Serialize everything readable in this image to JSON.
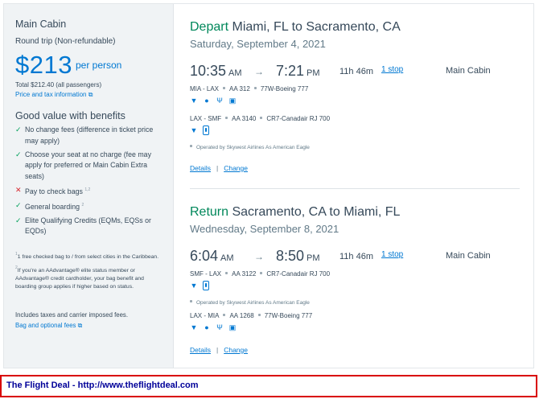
{
  "fare": {
    "cabin_name": "Main Cabin",
    "trip_type": "Round trip (Non-refundable)",
    "price_symbol": "$",
    "price_amount": "213",
    "price_suffix": "per person",
    "total_text": "Total $212.40 (all passengers)",
    "price_tax_link": "Price and tax information",
    "value_heading": "Good value with benefits",
    "benefits": [
      {
        "text": "No change fees (difference in ticket price may apply)",
        "status": "included"
      },
      {
        "text": "Choose your seat at no charge (fee may apply for preferred or Main Cabin Extra seats)",
        "status": "included"
      },
      {
        "text": "Pay to check bags",
        "sup": "1,2",
        "status": "not-included"
      },
      {
        "text": "General boarding",
        "sup": "2",
        "status": "included"
      },
      {
        "text": "Elite Qualifying Credits (EQMs, EQSs or EQDs)",
        "status": "included"
      }
    ],
    "notes": [
      {
        "sup": "1",
        "text": "1 free checked bag to / from select cities in the Caribbean."
      },
      {
        "sup": "2",
        "text": "If you're an AAdvantage® elite status member or AAdvantage® credit cardholder, your bag benefit and boarding group applies if higher based on status."
      }
    ],
    "includes_text": "Includes taxes and carrier imposed fees.",
    "bag_fees_link": "Bag and optional fees"
  },
  "depart": {
    "direction": "Depart",
    "route": "Miami, FL to Sacramento, CA",
    "date": "Saturday, September 4, 2021",
    "dep_time": "10:35",
    "dep_ampm": "AM",
    "arr_time": "7:21",
    "arr_ampm": "PM",
    "duration": "11h 46m",
    "stops": "1 stop",
    "cabin": "Main Cabin",
    "legs": [
      {
        "route": "MIA - LAX",
        "flight": "AA 312",
        "aircraft": "77W-Boeing 777",
        "amenities": [
          "wifi-icon",
          "entertainment-icon",
          "usb-power-icon",
          "meal-icon"
        ]
      },
      {
        "route": "LAX - SMF",
        "flight": "AA 3140",
        "aircraft": "CR7-Canadair RJ 700",
        "amenities": [
          "wifi-icon",
          "power-outlet-icon"
        ]
      }
    ],
    "operated_by": "Operated by Skywest Airlines As American Eagle",
    "details_link": "Details",
    "change_link": "Change"
  },
  "return": {
    "direction": "Return",
    "route": "Sacramento, CA to Miami, FL",
    "date": "Wednesday, September 8, 2021",
    "dep_time": "6:04",
    "dep_ampm": "AM",
    "arr_time": "8:50",
    "arr_ampm": "PM",
    "duration": "11h 46m",
    "stops": "1 stop",
    "cabin": "Main Cabin",
    "legs": [
      {
        "route": "SMF - LAX",
        "flight": "AA 3122",
        "aircraft": "CR7-Canadair RJ 700",
        "amenities": [
          "wifi-icon",
          "power-outlet-icon"
        ]
      },
      {
        "route": "LAX - MIA",
        "flight": "AA 1268",
        "aircraft": "77W-Boeing 777",
        "amenities": [
          "wifi-icon",
          "entertainment-icon",
          "usb-power-icon",
          "meal-icon"
        ]
      }
    ],
    "operated_by": "Operated by Skywest Airlines As American Eagle",
    "details_link": "Details",
    "change_link": "Change"
  },
  "footer": {
    "text": "The Flight Deal - http://www.theflightdeal.com"
  },
  "colors": {
    "accent": "#0078d2",
    "depart_green": "#00875a",
    "check_green": "#00a05a",
    "cross_red": "#d7262d",
    "footer_border": "#d90000",
    "footer_text": "#000099"
  }
}
